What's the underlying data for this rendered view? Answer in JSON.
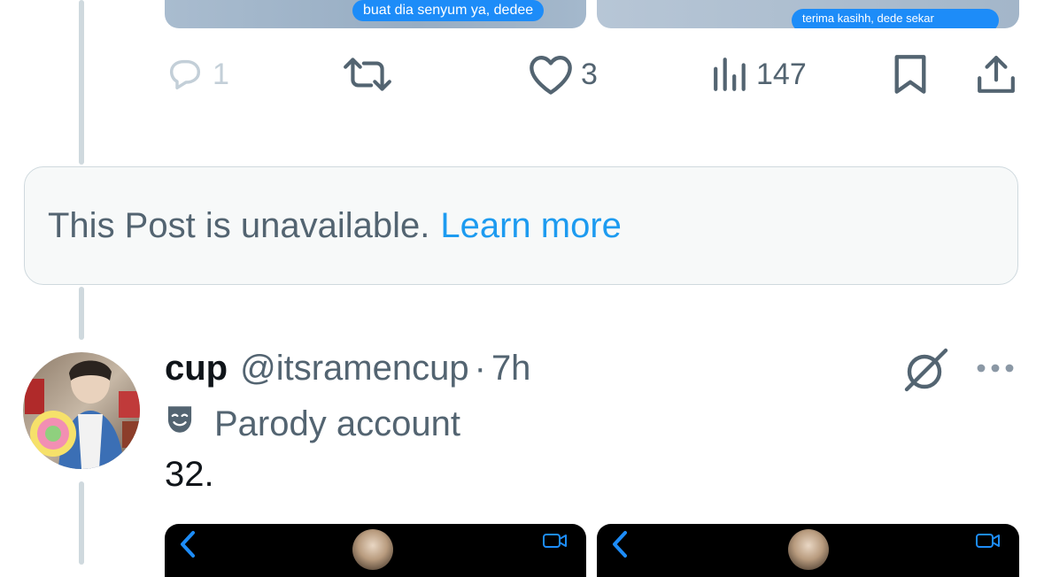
{
  "top_media": {
    "left_bubble_text": "buat dia senyum ya, dedee",
    "right_bubble_text": "terima kasihh, dede sekar"
  },
  "actions": {
    "reply_count": "1",
    "like_count": "3",
    "views_count": "147"
  },
  "unavailable": {
    "message": "This Post is unavailable.",
    "link_text": "Learn more"
  },
  "post": {
    "display_name": "cup",
    "handle": "@itsramencup",
    "separator": "·",
    "time": "7h",
    "account_label": "Parody account",
    "text": "32."
  },
  "colors": {
    "accent": "#1d9bf0",
    "secondary_text": "#536471",
    "border": "#cfd9de"
  }
}
